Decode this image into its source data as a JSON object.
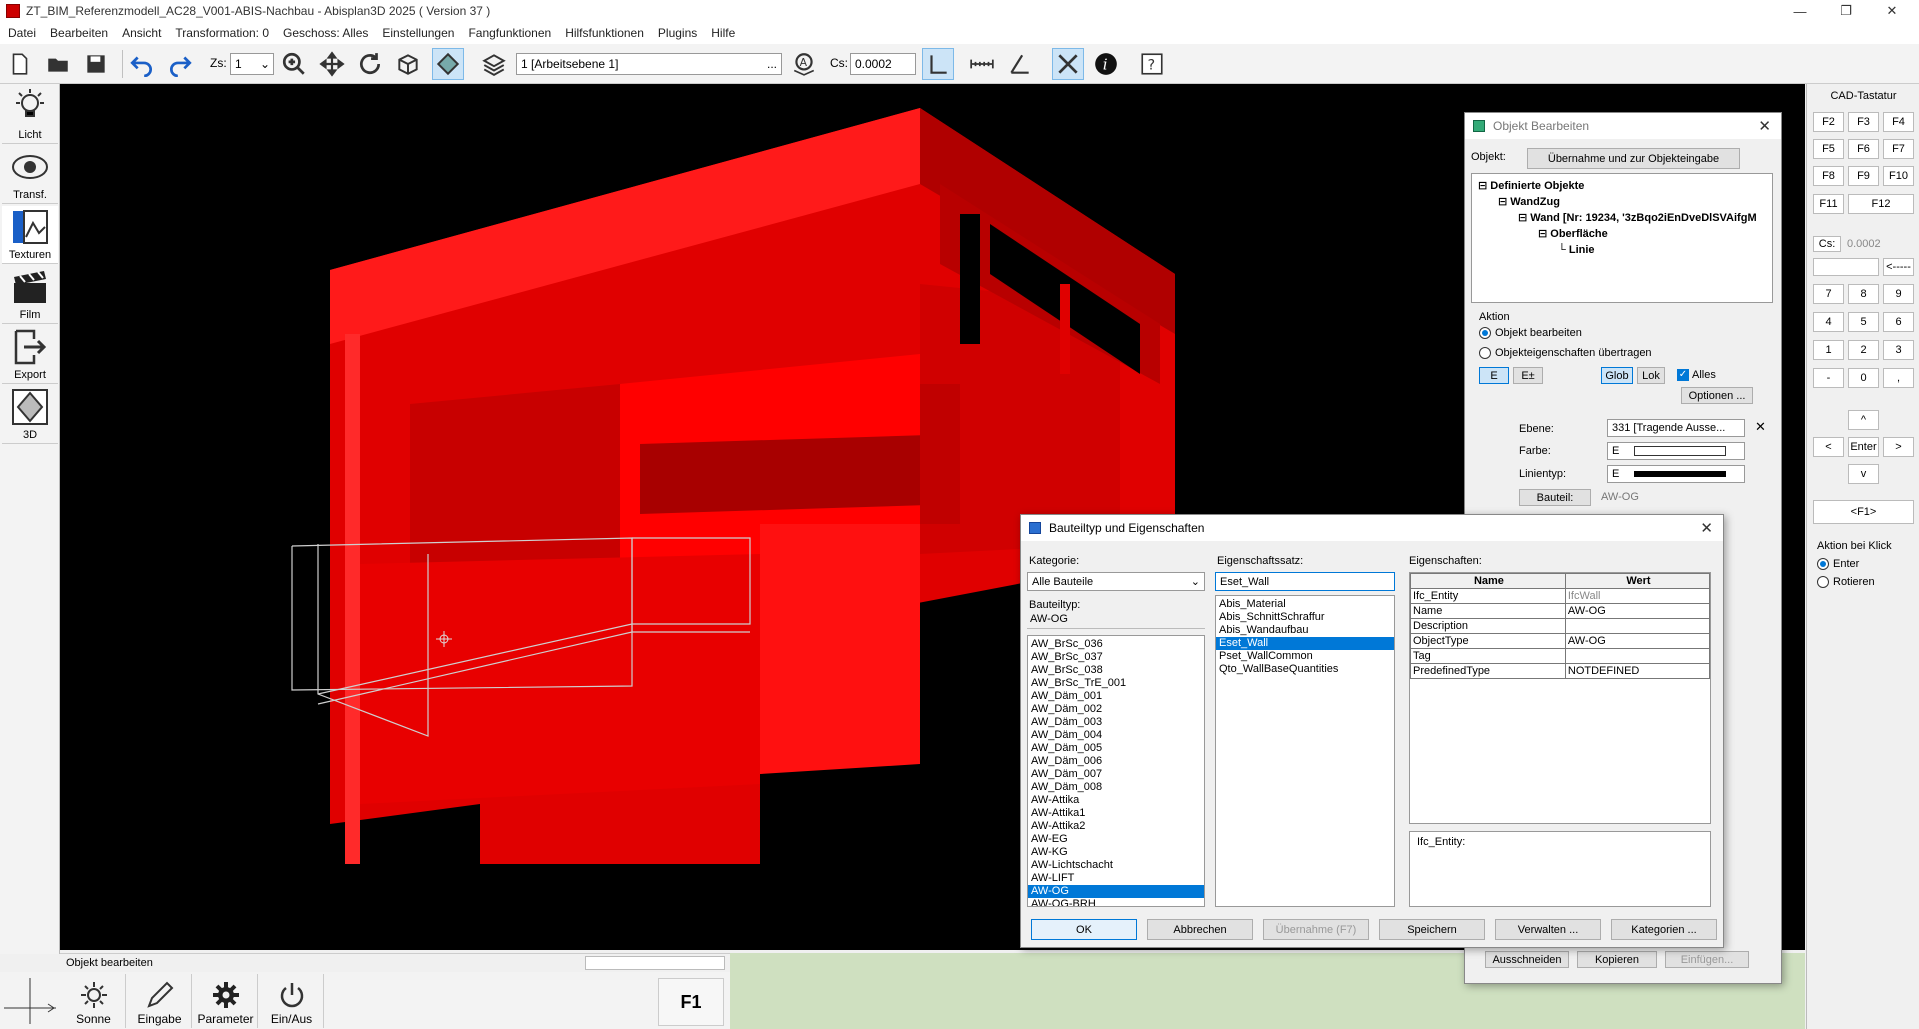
{
  "window": {
    "title": "ZT_BIM_Referenzmodell_AC28_V001-ABIS-Nachbau - Abisplan3D 2025 ( Version 37 )",
    "min": "—",
    "max": "❐",
    "close": "✕"
  },
  "menu": [
    "Datei",
    "Bearbeiten",
    "Ansicht",
    "Transformation: 0",
    "Geschoss: Alles",
    "Einstellungen",
    "Fangfunktionen",
    "Hilfsfunktionen",
    "Plugins",
    "Hilfe"
  ],
  "toolbar": {
    "zs_label": "Zs:",
    "zs_value": "1",
    "layer_value": "1 [Arbeitsebene 1]",
    "layer_btn": "...",
    "cs_label": "Cs:",
    "cs_value": "0.0002"
  },
  "left_tools": [
    "Licht",
    "Transf.",
    "Texturen",
    "Film",
    "Export",
    "3D"
  ],
  "status": {
    "text": "Objekt bearbeiten"
  },
  "bottom_tools": [
    "Sonne",
    "Eingabe",
    "Parameter",
    "Ein/Aus"
  ],
  "bottom_f1": "F1",
  "cad": {
    "title": "CAD-Tastatur",
    "fkeys": [
      "F2",
      "F3",
      "F4",
      "F5",
      "F6",
      "F7",
      "F8",
      "F9",
      "F10",
      "F11",
      "F12"
    ],
    "cs_label": "Cs:",
    "cs_value": "0.0002",
    "back": "<-----",
    "numpad": [
      "7",
      "8",
      "9",
      "4",
      "5",
      "6",
      "1",
      "2",
      "3",
      "-",
      "0",
      ","
    ],
    "up": "^",
    "left": "<",
    "enter": "Enter",
    "right": ">",
    "down": "v",
    "f1": "<F1>",
    "action_title": "Aktion bei Klick",
    "action_enter": "Enter",
    "action_rotate": "Rotieren"
  },
  "objekt": {
    "title": "Objekt Bearbeiten",
    "objekt_label": "Objekt:",
    "uebernahme": "Übernahme und zur Objekteingabe",
    "tree": [
      "Definierte Objekte",
      "WandZug",
      "Wand [Nr: 19234, '3zBqo2iEnDveDlSVAifgM",
      "Oberfläche",
      "Linie"
    ],
    "aktion": "Aktion",
    "radio1": "Objekt bearbeiten",
    "radio2": "Objekteigenschaften übertragen",
    "btn_e": "E",
    "btn_epm": "E±",
    "btn_glob": "Glob",
    "btn_lok": "Lok",
    "alles": "Alles",
    "optionen": "Optionen ...",
    "ebene_label": "Ebene:",
    "ebene_value": "331 [Tragende Ausse...",
    "farbe_label": "Farbe:",
    "farbe_value": "E",
    "linientyp_label": "Linientyp:",
    "linientyp_value": "E",
    "bauteil_btn": "Bauteil:",
    "bauteil_value": "AW-OG",
    "ausschneiden": "Ausschneiden",
    "kopieren": "Kopieren",
    "einfuegen": "Einfügen..."
  },
  "bauteil": {
    "title": "Bauteiltyp und Eigenschaften",
    "kategorie_label": "Kategorie:",
    "kategorie_value": "Alle Bauteile",
    "bauteiltyp_label": "Bauteiltyp:",
    "bauteiltyp_value": "AW-OG",
    "list": [
      "AW_BrSc_036",
      "AW_BrSc_037",
      "AW_BrSc_038",
      "AW_BrSc_TrE_001",
      "AW_Däm_001",
      "AW_Däm_002",
      "AW_Däm_003",
      "AW_Däm_004",
      "AW_Däm_005",
      "AW_Däm_006",
      "AW_Däm_007",
      "AW_Däm_008",
      "AW-Attika",
      "AW-Attika1",
      "AW-Attika2",
      "AW-EG",
      "AW-KG",
      "AW-Lichtschacht",
      "AW-LIFT",
      "AW-OG",
      "AW-OG-BRH"
    ],
    "selected": "AW-OG",
    "set_label": "Eigenschaftssatz:",
    "set_value": "Eset_Wall",
    "sets": [
      "Abis_Material",
      "Abis_SchnittSchraffur",
      "Abis_Wandaufbau",
      "Eset_Wall",
      "Pset_WallCommon",
      "Qto_WallBaseQuantities"
    ],
    "set_selected": "Eset_Wall",
    "props_label": "Eigenschaften:",
    "col_name": "Name",
    "col_value": "Wert",
    "rows": [
      [
        "Ifc_Entity",
        "IfcWall"
      ],
      [
        "Name",
        "AW-OG"
      ],
      [
        "Description",
        ""
      ],
      [
        "ObjectType",
        "AW-OG"
      ],
      [
        "Tag",
        ""
      ],
      [
        "PredefinedType",
        "NOTDEFINED"
      ]
    ],
    "desc": "Ifc_Entity:",
    "buttons": [
      "OK",
      "Abbrechen",
      "Übernahme (F7)",
      "Speichern",
      "Verwalten ...",
      "Kategorien ..."
    ]
  },
  "colors": {
    "model": "#ff0000",
    "accent": "#0078d7"
  }
}
